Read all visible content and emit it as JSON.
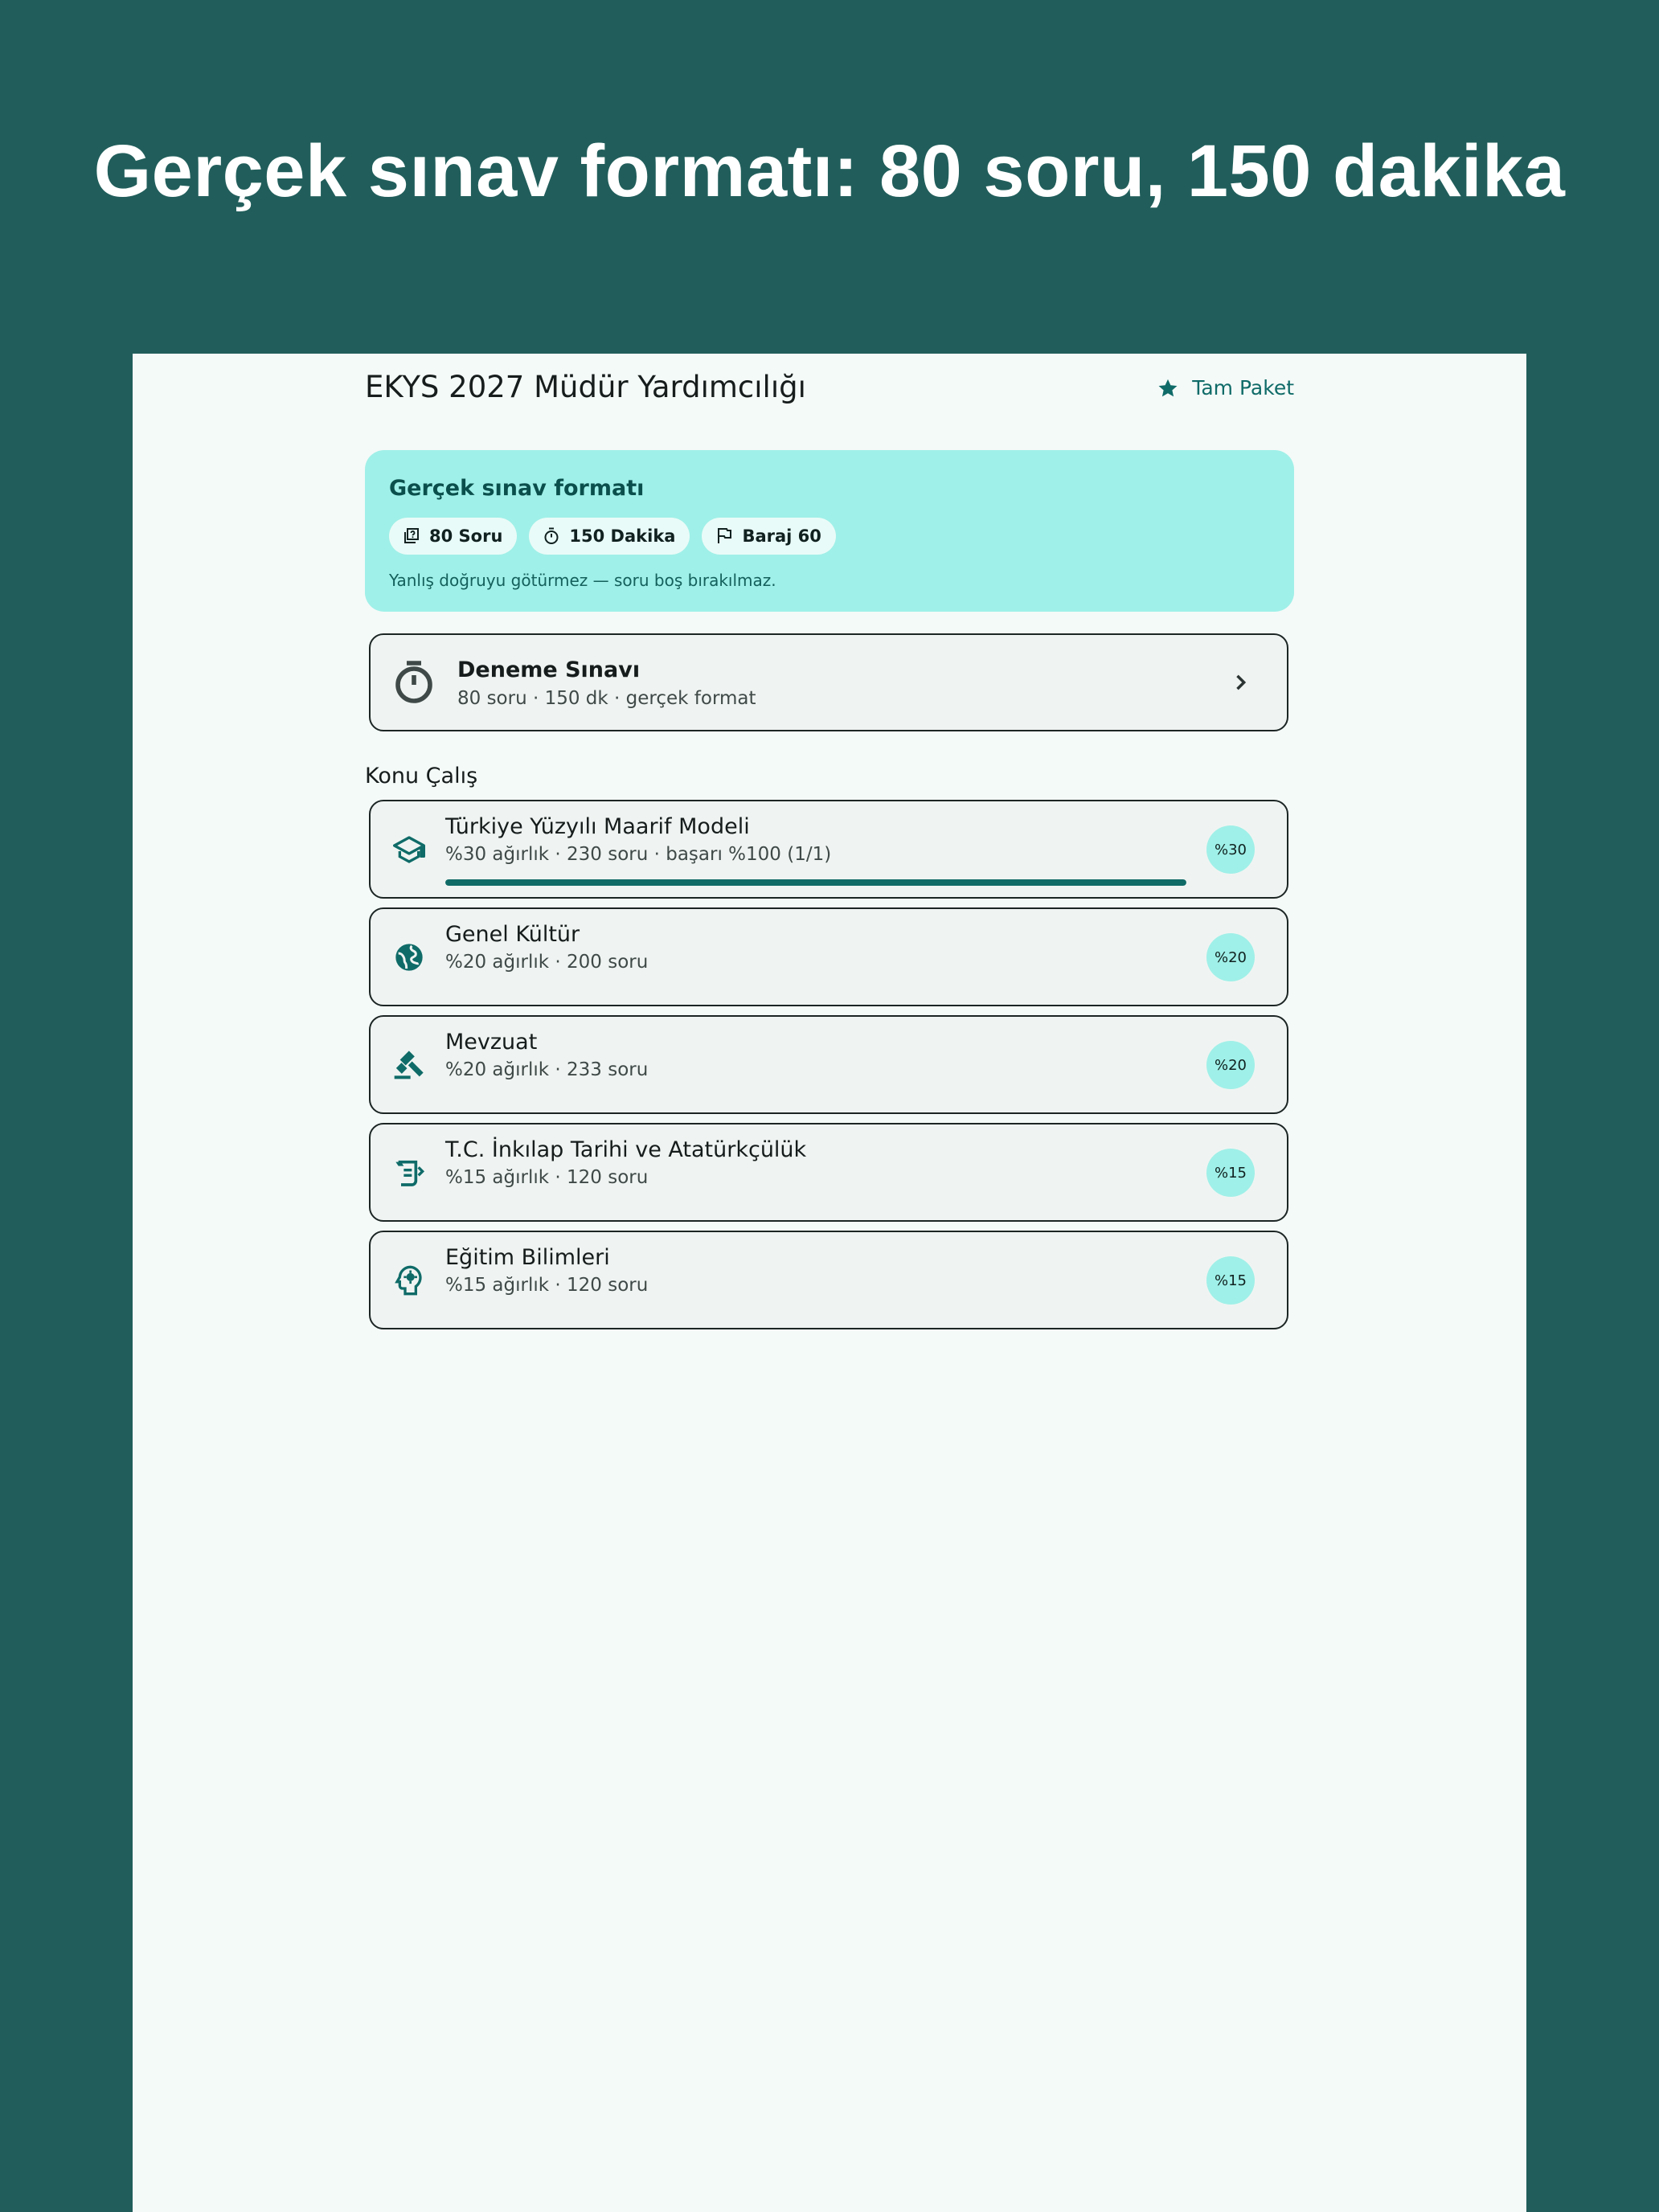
{
  "headline": "Gerçek sınav formatı: 80 soru, 150 dakika",
  "appbar": {
    "title": "EKYS 2027 Müdür Yardımcılığı",
    "package_label": "Tam Paket"
  },
  "format_card": {
    "title": "Gerçek sınav formatı",
    "chips": [
      {
        "icon": "question-box-icon",
        "label": "80 Soru"
      },
      {
        "icon": "timer-icon",
        "label": "150 Dakika"
      },
      {
        "icon": "flag-icon",
        "label": "Baraj 60"
      }
    ],
    "note": "Yanlış doğruyu götürmez — soru boş bırakılmaz."
  },
  "exam_card": {
    "icon": "timer-icon",
    "title": "Deneme Sınavı",
    "subtitle": "80 soru · 150 dk · gerçek format"
  },
  "section_title": "Konu Çalış",
  "topics": [
    {
      "icon": "graduation-cap-icon",
      "title": "Türkiye Yüzyılı Maarif Modeli",
      "subtitle": "%30 ağırlık · 230 soru · başarı %100 (1/1)",
      "badge": "%30",
      "progress": 1.0
    },
    {
      "icon": "globe-icon",
      "title": "Genel Kültür",
      "subtitle": "%20 ağırlık · 200 soru",
      "badge": "%20"
    },
    {
      "icon": "gavel-icon",
      "title": "Mevzuat",
      "subtitle": "%20 ağırlık · 233 soru",
      "badge": "%20"
    },
    {
      "icon": "history-scroll-icon",
      "title": "T.C. İnkılap Tarihi ve Atatürkçülük",
      "subtitle": "%15 ağırlık · 120 soru",
      "badge": "%15"
    },
    {
      "icon": "psychology-head-icon",
      "title": "Eğitim Bilimleri",
      "subtitle": "%15 ağırlık · 120 soru",
      "badge": "%15"
    }
  ],
  "colors": {
    "background": "#215e5b",
    "surface": "#f4faf8",
    "primary": "#0f6b68",
    "container": "#9ff0e8"
  }
}
